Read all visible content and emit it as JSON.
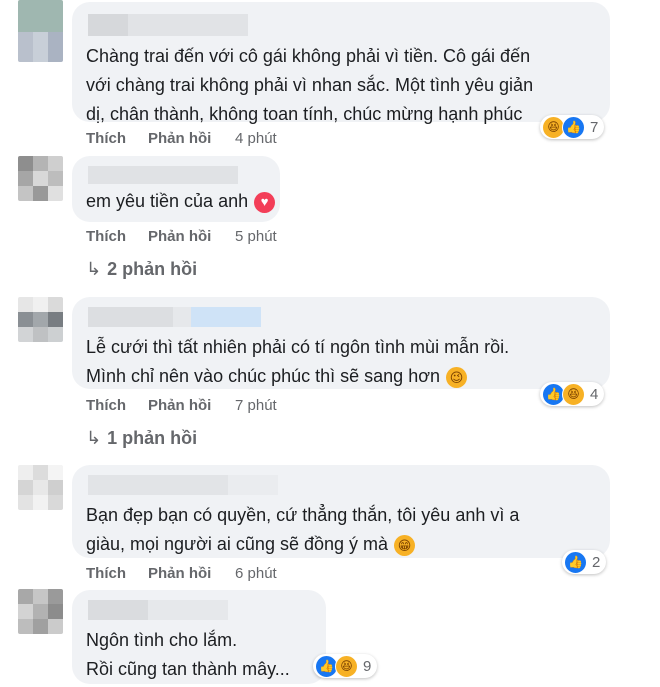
{
  "comments": [
    {
      "text_lines": [
        "Chàng trai đến với cô gái không phải vì tiền. Cô gái đến",
        "với chàng trai không phải vì nhan sắc. Một tình yêu giản",
        "dị, chân thành, không toan tính, chúc mừng hạnh phúc"
      ],
      "like_label": "Thích",
      "reply_label": "Phản hồi",
      "time": "4 phút",
      "reactions": [
        "haha-icon",
        "like-icon"
      ],
      "reaction_count": "7"
    },
    {
      "text_lines": [
        "em yêu tiền của anh"
      ],
      "inline_emoji": "heart-icon",
      "like_label": "Thích",
      "reply_label": "Phản hồi",
      "time": "5 phút",
      "replies_label": "2 phản hồi"
    },
    {
      "text_lines": [
        "Lễ cưới thì tất nhiên phải có tí ngôn tình mùi mẫn rồi.",
        "Mình chỉ nên vào chúc phúc thì sẽ sang hơn"
      ],
      "inline_emoji": "wink-face-icon",
      "like_label": "Thích",
      "reply_label": "Phản hồi",
      "time": "7 phút",
      "reactions": [
        "like-icon",
        "haha-icon"
      ],
      "reaction_count": "4",
      "replies_label": "1 phản hồi"
    },
    {
      "text_lines": [
        "Bạn đẹp bạn có quyền, cứ thẳng thắn, tôi yêu anh vì a",
        "giàu, mọi người ai cũng sẽ đồng ý mà"
      ],
      "inline_emoji": "grin-face-icon",
      "like_label": "Thích",
      "reply_label": "Phản hồi",
      "time": "6 phút",
      "reactions": [
        "like-icon"
      ],
      "reaction_count": "2"
    },
    {
      "text_lines": [
        "Ngôn tình cho lắm.",
        "Rồi cũng tan thành mây..."
      ],
      "reactions": [
        "like-icon",
        "haha-icon"
      ],
      "reaction_count": "9"
    }
  ],
  "colors": {
    "bubble": "#f0f2f5",
    "meta": "#65676b",
    "like": "#1877f2",
    "haha": "#f7b125",
    "love": "#f33e58"
  }
}
